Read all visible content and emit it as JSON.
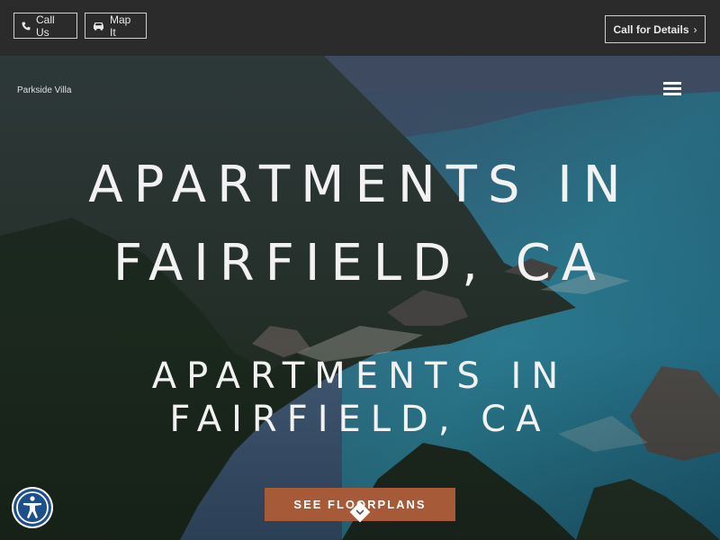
{
  "topbar": {
    "call_label": "Call Us",
    "map_label": "Map It",
    "details_label": "Call for Details",
    "details_chevron": "›"
  },
  "header": {
    "brand": "Parkside Villa"
  },
  "hero": {
    "heading_line1": "APARTMENTS IN",
    "heading_line2": "FAIRFIELD, CA",
    "subheading_line1": "APARTMENTS IN",
    "subheading_line2": "FAIRFIELD, CA",
    "cta_label": "SEE FLOORPLANS"
  },
  "colors": {
    "topbar": "#2b2b2b",
    "cta": "#a75a38",
    "accessibility": "#1d4f8c"
  },
  "icons": {
    "call": "phone-icon",
    "map": "car-icon",
    "menu": "hamburger-icon",
    "scroll": "chevron-down-icon",
    "access": "accessibility-icon"
  }
}
